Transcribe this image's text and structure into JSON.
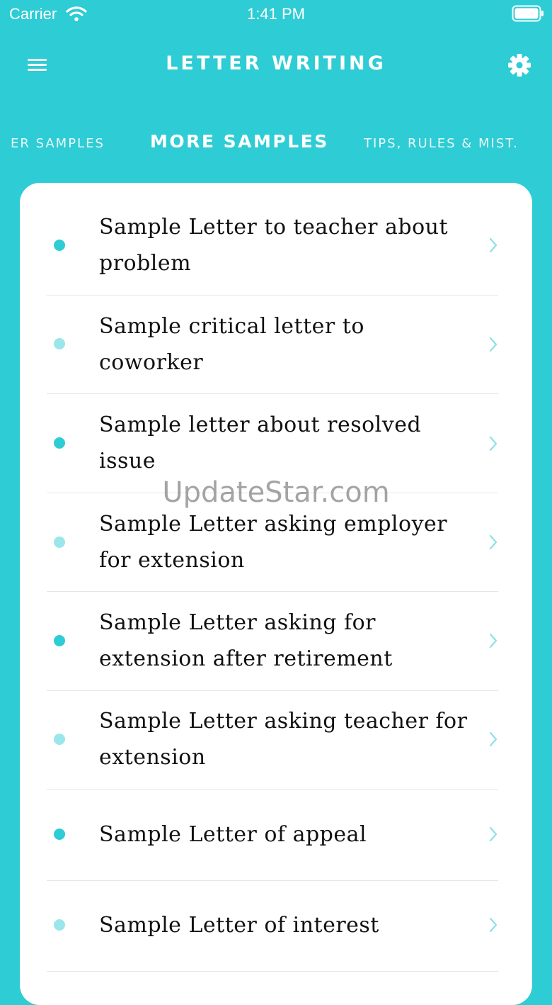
{
  "status_bar": {
    "carrier": "Carrier",
    "time": "1:41 PM"
  },
  "header": {
    "title": "LETTER WRITING"
  },
  "tabs": {
    "previous": "ER SAMPLES",
    "active": "MORE SAMPLES",
    "next": "TIPS, RULES & MIST."
  },
  "list": {
    "items": [
      {
        "label": "Sample Letter to teacher about problem"
      },
      {
        "label": "Sample critical letter to coworker"
      },
      {
        "label": "Sample letter about resolved issue"
      },
      {
        "label": "Sample Letter asking employer for extension"
      },
      {
        "label": "Sample Letter asking for extension after retirement"
      },
      {
        "label": "Sample Letter asking teacher for extension"
      },
      {
        "label": "Sample Letter of  appeal"
      },
      {
        "label": "Sample Letter of interest"
      }
    ]
  },
  "watermark": "UpdateStar.com",
  "colors": {
    "background": "#2ECCD4",
    "bullet_dark": "#2ECCD4",
    "bullet_light": "#9BE6EA",
    "chevron": "#8FE0E5"
  },
  "icons": {
    "menu": "hamburger-menu-icon",
    "settings": "gear-icon",
    "row_chevron": "chevron-right-icon",
    "wifi": "wifi-icon",
    "battery": "battery-icon"
  }
}
